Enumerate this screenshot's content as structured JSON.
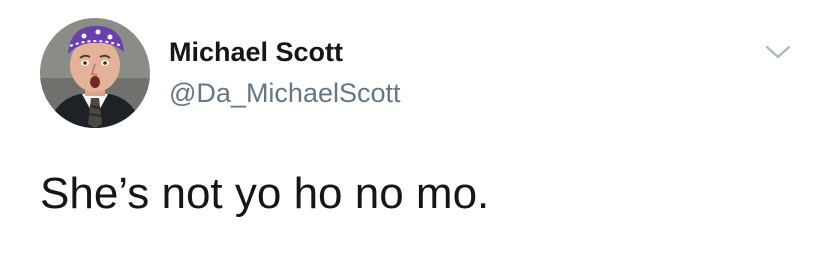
{
  "tweet": {
    "author": {
      "display_name": "Michael Scott",
      "handle": "@Da_MichaelScott",
      "avatar_icon": "profile-photo"
    },
    "menu_icon": "chevron-down-icon",
    "text": "She’s not yo ho no mo."
  },
  "colors": {
    "name": "#14171a",
    "handle": "#657786",
    "caret": "#aab8c2",
    "background": "#ffffff"
  }
}
